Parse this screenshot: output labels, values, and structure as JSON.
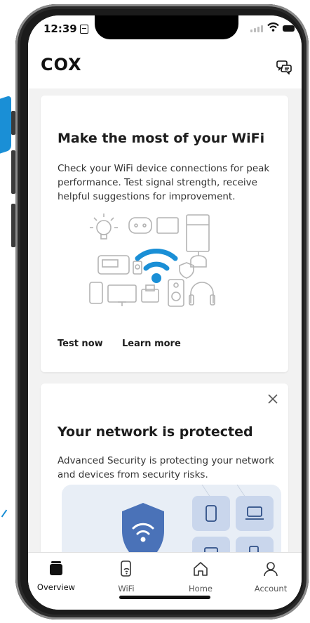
{
  "status_bar": {
    "time": "12:39"
  },
  "app": {
    "logo": "COX"
  },
  "wifi_card": {
    "title": "Make the most of your WiFi",
    "description": "Check your WiFi device connections for peak performance. Test signal strength, receive helpful suggestions for improvement.",
    "actions": [
      "Test now",
      "Learn more"
    ]
  },
  "security_card": {
    "title": "Your network is protected",
    "description": "Advanced Security is protecting your network and devices from security risks."
  },
  "tabs": [
    {
      "label": "Overview",
      "icon": "overview-icon",
      "active": true
    },
    {
      "label": "WiFi",
      "icon": "wifi-device-icon",
      "active": false
    },
    {
      "label": "Home",
      "icon": "home-icon",
      "active": false
    },
    {
      "label": "Account",
      "icon": "account-icon",
      "active": false
    }
  ],
  "colors": {
    "accent": "#1a8fd6",
    "shield": "#4a72b8",
    "panel": "#e8eef6"
  }
}
